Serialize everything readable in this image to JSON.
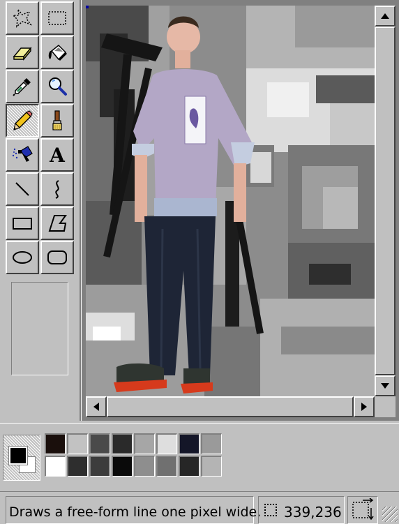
{
  "toolbox": {
    "tools": [
      {
        "name": "free-form-select",
        "icon": "free-form-select-icon",
        "selected": false
      },
      {
        "name": "select",
        "icon": "rect-select-icon",
        "selected": false
      },
      {
        "name": "eraser",
        "icon": "eraser-icon",
        "selected": false
      },
      {
        "name": "fill-with-color",
        "icon": "paint-bucket-icon",
        "selected": false
      },
      {
        "name": "pick-color",
        "icon": "eyedropper-icon",
        "selected": false
      },
      {
        "name": "magnifier",
        "icon": "magnifier-icon",
        "selected": false
      },
      {
        "name": "pencil",
        "icon": "pencil-icon",
        "selected": true
      },
      {
        "name": "brush",
        "icon": "brush-icon",
        "selected": false
      },
      {
        "name": "airbrush",
        "icon": "airbrush-icon",
        "selected": false
      },
      {
        "name": "text",
        "icon": "text-icon",
        "selected": false
      },
      {
        "name": "line",
        "icon": "line-icon",
        "selected": false
      },
      {
        "name": "curve",
        "icon": "curve-icon",
        "selected": false
      },
      {
        "name": "rectangle",
        "icon": "rectangle-icon",
        "selected": false
      },
      {
        "name": "polygon",
        "icon": "polygon-icon",
        "selected": false
      },
      {
        "name": "ellipse",
        "icon": "ellipse-icon",
        "selected": false
      },
      {
        "name": "rounded-rectangle",
        "icon": "rounded-rectangle-icon",
        "selected": false
      }
    ],
    "text_tool_glyph": "A"
  },
  "palette": {
    "foreground": "#000000",
    "background": "#ffffff",
    "colors": [
      "#1a0f0c",
      "#c2c2c2",
      "#4a4a4a",
      "#2a2a2a",
      "#a6a6a6",
      "#dedede",
      "#141628",
      "#9a9a9a",
      "#ffffff",
      "#2e2e2e",
      "#3c3c3c",
      "#0a0a0a",
      "#8e8e8e",
      "#707070",
      "#262626",
      "#b4b4b4"
    ]
  },
  "status": {
    "help_text": "Draws a free-form line one pixel wide.",
    "cursor_position": "339,236"
  },
  "colors": {
    "chrome": "#c0c0c0",
    "workspace": "#808080",
    "selection_handle": "#0000a0"
  }
}
